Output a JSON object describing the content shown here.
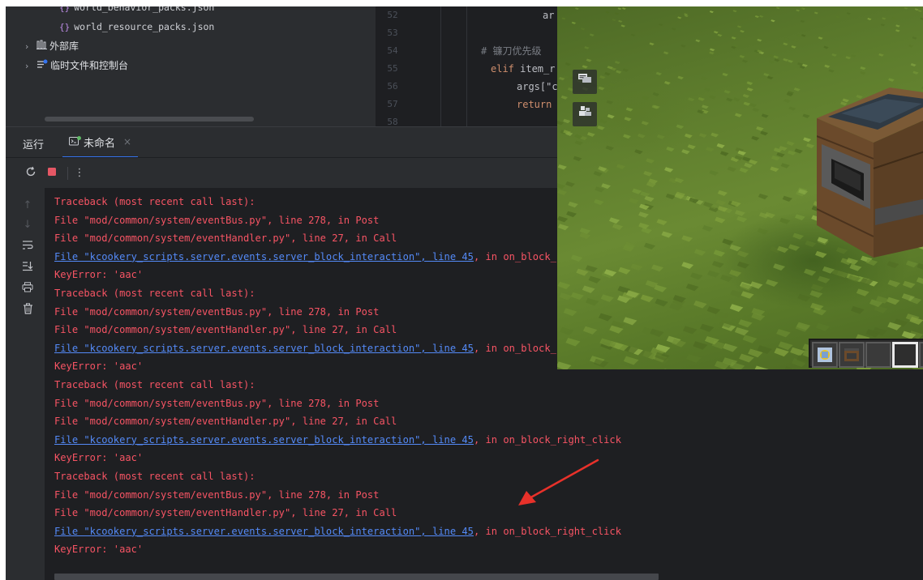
{
  "project_tree": {
    "items": [
      {
        "label": "world_behavior_packs.json",
        "kind": "json"
      },
      {
        "label": "world_resource_packs.json",
        "kind": "json"
      },
      {
        "label": "外部库",
        "kind": "folder"
      },
      {
        "label": "临时文件和控制台",
        "kind": "folder"
      }
    ],
    "json_icon": "{}"
  },
  "editor": {
    "line_numbers": [
      "52",
      "53",
      "54",
      "55",
      "56",
      "57",
      "58"
    ],
    "lines": [
      {
        "kw": "",
        "text": "ar"
      },
      {
        "kw": "",
        "text": ""
      },
      {
        "kw": "",
        "text": "# 镰刀优先级"
      },
      {
        "kw": "elif",
        "text": " item_r"
      },
      {
        "kw": "",
        "text": "args[\"c"
      },
      {
        "kw": "return",
        "text": ""
      },
      {
        "kw": "",
        "text": ""
      }
    ]
  },
  "run_panel": {
    "title": "运行",
    "tab_label": "未命名",
    "tab_close": "×",
    "toolbar": {
      "rerun_icon": "rerun-icon",
      "stop_icon": "stop-icon",
      "more_icon": "more-icon"
    }
  },
  "console": {
    "gutter_icons": [
      "up-arrow-icon",
      "down-arrow-icon",
      "soft-wrap-icon",
      "scroll-to-end-icon",
      "print-icon",
      "trash-icon"
    ],
    "lines": [
      {
        "text": "Traceback (most recent call last):"
      },
      {
        "text": "File \"mod/common/system/eventBus.py\", line 278, in Post"
      },
      {
        "text": "File \"mod/common/system/eventHandler.py\", line 27, in Call"
      },
      {
        "link": "File \"kcookery_scripts.server.events.server_block_interaction\", line 45",
        "text": ", in on_block_right_click"
      },
      {
        "text": "KeyError: 'aac'"
      },
      {
        "text": "Traceback (most recent call last):"
      },
      {
        "text": "File \"mod/common/system/eventBus.py\", line 278, in Post"
      },
      {
        "text": "File \"mod/common/system/eventHandler.py\", line 27, in Call"
      },
      {
        "link": "File \"kcookery_scripts.server.events.server_block_interaction\", line 45",
        "text": ", in on_block_right_click"
      },
      {
        "text": "KeyError: 'aac'"
      },
      {
        "text": "Traceback (most recent call last):"
      },
      {
        "text": "File \"mod/common/system/eventBus.py\", line 278, in Post"
      },
      {
        "text": "File \"mod/common/system/eventHandler.py\", line 27, in Call"
      },
      {
        "link": "File \"kcookery_scripts.server.events.server_block_interaction\", line 45",
        "text": ", in on_block_right_click"
      },
      {
        "text": "KeyError: 'aac'"
      },
      {
        "text": "Traceback (most recent call last):"
      },
      {
        "text": "File \"mod/common/system/eventBus.py\", line 278, in Post"
      },
      {
        "text": "File \"mod/common/system/eventHandler.py\", line 27, in Call"
      },
      {
        "link": "File \"kcookery_scripts.server.events.server_block_interaction\", line 45",
        "text": ", in on_block_right_click"
      },
      {
        "text": "KeyError: 'aac'"
      }
    ]
  },
  "game_window": {
    "side_buttons": [
      "chat-icon",
      "players-icon"
    ],
    "hotbar": {
      "slots": 5,
      "selected_slot": 4
    }
  },
  "colors": {
    "error_text": "#f75464",
    "link_text": "#548af7",
    "annotation_arrow": "#e8312a",
    "accent": "#3574f0"
  }
}
